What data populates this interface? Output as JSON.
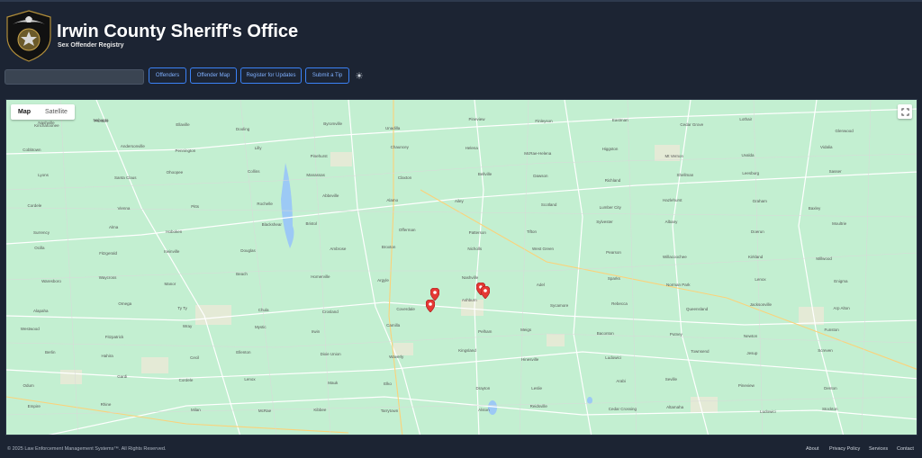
{
  "header": {
    "title": "Irwin County Sheriff's Office",
    "subtitle": "Sex Offender Registry"
  },
  "toolbar": {
    "search_value": "",
    "search_placeholder": "",
    "buttons": [
      "Offenders",
      "Offender Map",
      "Register for Updates",
      "Submit a Tip"
    ]
  },
  "map": {
    "toggle": [
      "Map",
      "Satellite"
    ],
    "active_view": "Map",
    "towns": [
      "Kinchafoonee",
      "Preston",
      "Ellaville",
      "Dooling",
      "Byromville",
      "Unadilla",
      "Pineview",
      "Finleyson",
      "Eastman",
      "Cedar Grove",
      "Lothair",
      "Glenwood",
      "Cobbtown",
      "Andersonville",
      "Pennington",
      "Lilly",
      "Pinehurst",
      "Chauncey",
      "Helena",
      "McRae-Helena",
      "Higgston",
      "Mt Vernon",
      "Uvalda",
      "Vidalia",
      "Lyons",
      "Santa Claus",
      "Ohoopee",
      "Collins",
      "Manassas",
      "Claxton",
      "Bellville",
      "Dawson",
      "Richland",
      "Shellman",
      "Leesburg",
      "Sasser",
      "Cordele",
      "Vienna",
      "Pitts",
      "Rochelle",
      "Abbeville",
      "Alamo",
      "Ailey",
      "Scotland",
      "Lumber City",
      "Hazlehurst",
      "Graham",
      "Baxley",
      "Surrency",
      "Alma",
      "Hoboken",
      "Blackshear",
      "Bristol",
      "Offerman",
      "Patterson",
      "Tifton",
      "Sylvester",
      "Albany",
      "Doerun",
      "Moultrie",
      "Ocilla",
      "Fitzgerald",
      "Irwinville",
      "Douglas",
      "Ambrose",
      "Broxton",
      "Nicholls",
      "West Green",
      "Pearson",
      "Willacoochee",
      "Kirkland",
      "Millwood",
      "Waresboro",
      "Waycross",
      "Manor",
      "Beach",
      "Homerville",
      "Argyle",
      "Nashville",
      "Adel",
      "Sparks",
      "Norman Park",
      "Lenox",
      "Enigma",
      "Alapaha",
      "Omega",
      "Ty Ty",
      "Chula",
      "Crosland",
      "Coverdale",
      "Ashburn",
      "Sycamore",
      "Rebecca",
      "Queensland",
      "Jacksonville",
      "Arp Alton",
      "Westwood",
      "Fitzpatrick",
      "Wray",
      "Mystic",
      "Irwin",
      "Camilla",
      "Pelham",
      "Meigs",
      "Baconton",
      "Putney",
      "Newton",
      "Funston",
      "Berlin",
      "Hahira",
      "Cecil",
      "Ellenton",
      "Dixie Union",
      "Waverly",
      "Kingsland",
      "Hinesville",
      "Ludowici",
      "Townsend",
      "Jesup",
      "Screven",
      "Odum",
      "Gardi",
      "Cordele",
      "Lenox",
      "Mauk",
      "Elko",
      "Drayton",
      "Leslie",
      "Arabi",
      "Seville",
      "Pineview",
      "Denton",
      "Empire",
      "Rhine",
      "Milan",
      "McRae",
      "Kibbee",
      "Tarrytown",
      "Alston",
      "Reidsville",
      "Cedar Crossing",
      "Altamaha",
      "Ludowici",
      "Stockton",
      "Nashville",
      "Nahunta"
    ],
    "pins": [
      {
        "label": "Offender location",
        "lat_frac": 0.58,
        "lng_frac": 0.52
      },
      {
        "label": "Offender location",
        "lat_frac": 0.59,
        "lng_frac": 0.525
      },
      {
        "label": "Offender location",
        "lat_frac": 0.595,
        "lng_frac": 0.47
      },
      {
        "label": "Offender location",
        "lat_frac": 0.63,
        "lng_frac": 0.465
      }
    ]
  },
  "footer": {
    "copyright": "© 2025 Law Enforcement Management Systems™. All Rights Reserved.",
    "links": [
      "About",
      "Privacy Policy",
      "Services",
      "Contact"
    ]
  },
  "colors": {
    "background": "#1c2433",
    "accent": "#3b82f6",
    "map_land": "#c3efd1",
    "pin": "#e53935"
  }
}
